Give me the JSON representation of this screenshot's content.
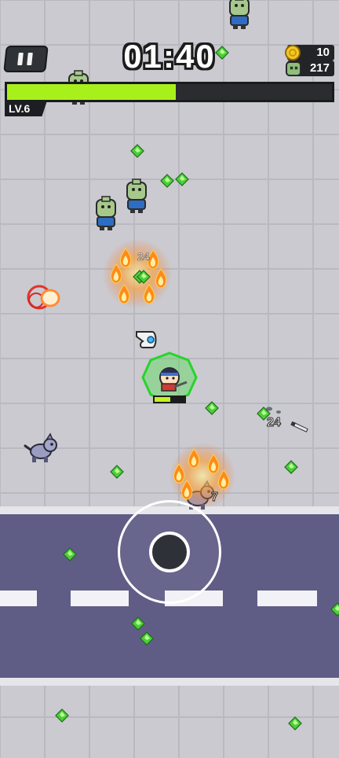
{
  "hud": {
    "timer": "01:40",
    "coins": "10",
    "kills": "217",
    "level_label": "LV.6",
    "xp_progress": 0.52
  },
  "damage_numbers": [
    "24",
    "24",
    "7"
  ],
  "colors": {
    "xp_fill": "#a8f01c",
    "gem": "#4ccf3a",
    "road": "#5f5d86",
    "floor": "#c9c9cf",
    "aura": "#39e23a",
    "fire": "#ff8c1a"
  },
  "icons": {
    "pause": "pause-icon",
    "coin": "coin-icon",
    "kills": "zombie-head-icon",
    "joystick": "joystick"
  }
}
